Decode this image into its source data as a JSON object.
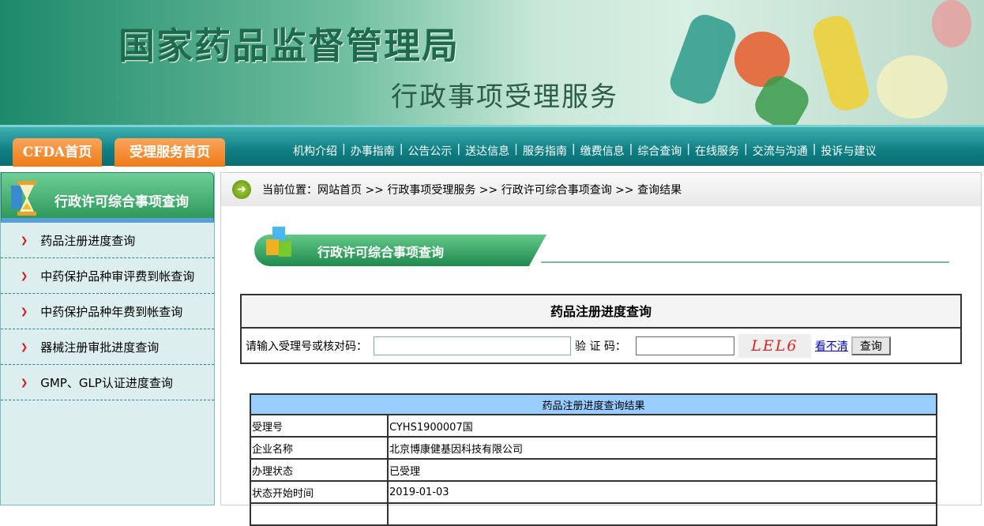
{
  "banner": {
    "title": "国家药品监督管理局",
    "subtitle": "行政事项受理服务"
  },
  "nav": {
    "tabs": [
      "CFDA首页",
      "受理服务首页"
    ],
    "links": [
      "机构介绍",
      "办事指南",
      "公告公示",
      "送达信息",
      "服务指南",
      "缴费信息",
      "综合查询",
      "在线服务",
      "交流与沟通",
      "投诉与建议"
    ]
  },
  "sidebar": {
    "title": "行政许可综合事项查询",
    "items": [
      "药品注册进度查询",
      "中药保护品种审评费到帐查询",
      "中药保护品种年费到帐查询",
      "器械注册审批进度查询",
      "GMP、GLP认证进度查询"
    ]
  },
  "breadcrumb": "当前位置：网站首页 >> 行政事项受理服务 >> 行政许可综合事项查询 >> 查询结果",
  "section_title": "行政许可综合事项查询",
  "query": {
    "title": "药品注册进度查询",
    "id_label": "请输入受理号或核对码：",
    "id_value": "",
    "code_label": "验 证 码：",
    "code_value": "",
    "captcha": "LEL6",
    "refresh_link": "看不清",
    "submit": "查询"
  },
  "result": {
    "title": "药品注册进度查询结果",
    "rows": [
      [
        "受理号",
        "CYHS1900007国"
      ],
      [
        "企业名称",
        "北京博康健基因科技有限公司"
      ],
      [
        "办理状态",
        "已受理"
      ],
      [
        "状态开始时间",
        "2019-01-03"
      ]
    ]
  }
}
